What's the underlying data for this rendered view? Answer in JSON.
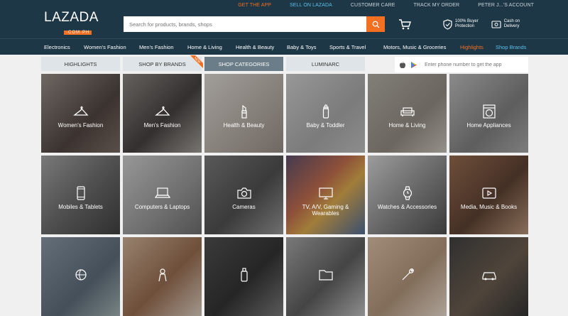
{
  "topbar": {
    "get_app": "GET THE APP",
    "sell": "SELL ON LAZADA",
    "care": "CUSTOMER CARE",
    "track": "TRACK MY ORDER",
    "account": "PETER J...'S ACCOUNT"
  },
  "logo": {
    "name": "LAZADA",
    "sub": "·COM·PH"
  },
  "search": {
    "placeholder": "Search for products, brands, shops"
  },
  "assurances": [
    {
      "line1": "100% Buyer",
      "line2": "Protection"
    },
    {
      "line1": "Cash on",
      "line2": "Delivery"
    }
  ],
  "nav": [
    "Electronics",
    "Women's Fashion",
    "Men's Fashion",
    "Home & Living",
    "Health & Beauty",
    "Baby & Toys",
    "Sports & Travel",
    "Motors, Music & Groceries",
    "Highlights",
    "Shop Brands"
  ],
  "tabs": [
    "HIGHLIGHTS",
    "SHOP BY BRANDS",
    "SHOP CATEGORIES",
    "LUMINARC"
  ],
  "tab_badge": "NEW",
  "app_phone_placeholder": "Enter phone number to get the app",
  "categories": [
    {
      "label": "Women's Fashion",
      "icon": "hanger-icon"
    },
    {
      "label": "Men's Fashion",
      "icon": "hanger-icon"
    },
    {
      "label": "Health & Beauty",
      "icon": "lipstick-icon"
    },
    {
      "label": "Baby & Toddler",
      "icon": "baby-bottle-icon"
    },
    {
      "label": "Home & Living",
      "icon": "sofa-icon"
    },
    {
      "label": "Home Appliances",
      "icon": "washing-machine-icon"
    },
    {
      "label": "Mobiles & Tablets",
      "icon": "phone-icon"
    },
    {
      "label": "Computers & Laptops",
      "icon": "laptop-icon"
    },
    {
      "label": "Cameras",
      "icon": "camera-icon"
    },
    {
      "label": "TV, A/V, Gaming & Wearables",
      "icon": "tv-icon"
    },
    {
      "label": "Watches & Accessories",
      "icon": "watch-icon"
    },
    {
      "label": "Media, Music & Books",
      "icon": "play-icon"
    },
    {
      "label": "",
      "icon": "ball-icon"
    },
    {
      "label": "",
      "icon": "toy-icon"
    },
    {
      "label": "",
      "icon": "bottle-icon"
    },
    {
      "label": "",
      "icon": "folder-icon"
    },
    {
      "label": "",
      "icon": "tool-icon"
    },
    {
      "label": "",
      "icon": "car-icon"
    }
  ],
  "colors": {
    "brand_dark": "#1e3746",
    "accent": "#f36f21",
    "link_blue": "#5bc0eb"
  }
}
